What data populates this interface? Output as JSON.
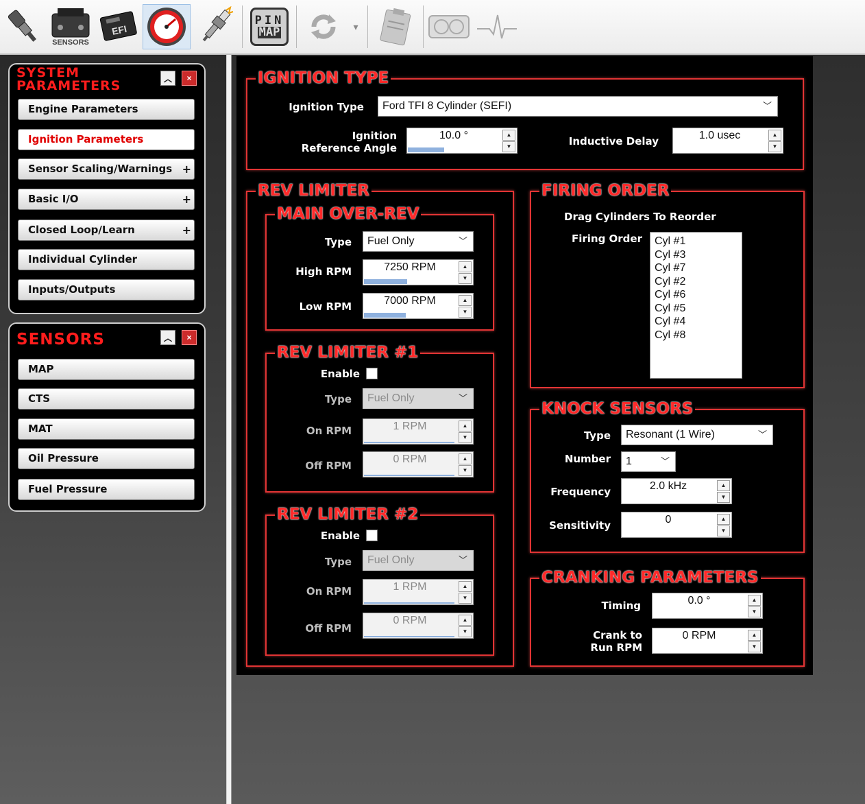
{
  "toolbar": {
    "icons": [
      "injector-icon",
      "sensors-icon",
      "efi-module-icon",
      "gauge-icon",
      "spark-plug-icon",
      "pin-map-icon",
      "refresh-icon",
      "clipboard-icon",
      "dashboard-icon",
      "pulse-icon"
    ],
    "sensors_caption": "SENSORS",
    "pin_map_line1": "PIN",
    "pin_map_line2": "MAP"
  },
  "system_parameters": {
    "title_line1": "SYSTEM",
    "title_line2": "PARAMETERS",
    "items": [
      {
        "label": "Engine Parameters",
        "expandable": false
      },
      {
        "label": "Ignition Parameters",
        "expandable": false,
        "active": true
      },
      {
        "label": "Sensor Scaling/Warnings",
        "expandable": true
      },
      {
        "label": "Basic I/O",
        "expandable": true
      },
      {
        "label": "Closed Loop/Learn",
        "expandable": true
      },
      {
        "label": "Individual Cylinder",
        "expandable": false
      },
      {
        "label": "Inputs/Outputs",
        "expandable": false
      }
    ],
    "plus": "+"
  },
  "sensors": {
    "title": "SENSORS",
    "items": [
      {
        "label": "MAP"
      },
      {
        "label": "CTS"
      },
      {
        "label": "MAT"
      },
      {
        "label": "Oil Pressure"
      },
      {
        "label": "Fuel Pressure"
      }
    ]
  },
  "ignition_type": {
    "title": "IGNITION TYPE",
    "type_label": "Ignition Type",
    "type_value": "Ford TFI 8 Cylinder (SEFI)",
    "ref_angle_label_1": "Ignition",
    "ref_angle_label_2": "Reference Angle",
    "ref_angle_value": "10.0 °",
    "inductive_delay_label": "Inductive Delay",
    "inductive_delay_value": "1.0 usec"
  },
  "rev_limiter": {
    "title": "REV LIMITER",
    "main": {
      "title": "MAIN OVER-REV",
      "type_label": "Type",
      "type_value": "Fuel Only",
      "high_label": "High RPM",
      "high_value": "7250 RPM",
      "low_label": "Low RPM",
      "low_value": "7000 RPM"
    },
    "limiter1": {
      "title": "REV LIMITER #1",
      "enable_label": "Enable",
      "type_label": "Type",
      "type_value": "Fuel Only",
      "on_label": "On RPM",
      "on_value": "1 RPM",
      "off_label": "Off RPM",
      "off_value": "0 RPM"
    },
    "limiter2": {
      "title": "REV LIMITER #2",
      "enable_label": "Enable",
      "type_label": "Type",
      "type_value": "Fuel Only",
      "on_label": "On RPM",
      "on_value": "1 RPM",
      "off_label": "Off RPM",
      "off_value": "0 RPM"
    }
  },
  "firing_order": {
    "title": "FIRING ORDER",
    "hint": "Drag Cylinders To Reorder",
    "label": "Firing Order",
    "cylinders": [
      "Cyl #1",
      "Cyl #3",
      "Cyl #7",
      "Cyl #2",
      "Cyl #6",
      "Cyl #5",
      "Cyl #4",
      "Cyl #8"
    ]
  },
  "knock_sensors": {
    "title": "KNOCK SENSORS",
    "type_label": "Type",
    "type_value": "Resonant (1 Wire)",
    "number_label": "Number",
    "number_value": "1",
    "frequency_label": "Frequency",
    "frequency_value": "2.0 kHz",
    "sensitivity_label": "Sensitivity",
    "sensitivity_value": "0"
  },
  "cranking": {
    "title": "CRANKING PARAMETERS",
    "timing_label": "Timing",
    "timing_value": "0.0 °",
    "crank_label_1": "Crank to",
    "crank_label_2": "Run RPM",
    "crank_value": "0 RPM"
  },
  "colors": {
    "accent": "#ff2a2a",
    "frame": "#e23434",
    "panel": "#000000"
  }
}
